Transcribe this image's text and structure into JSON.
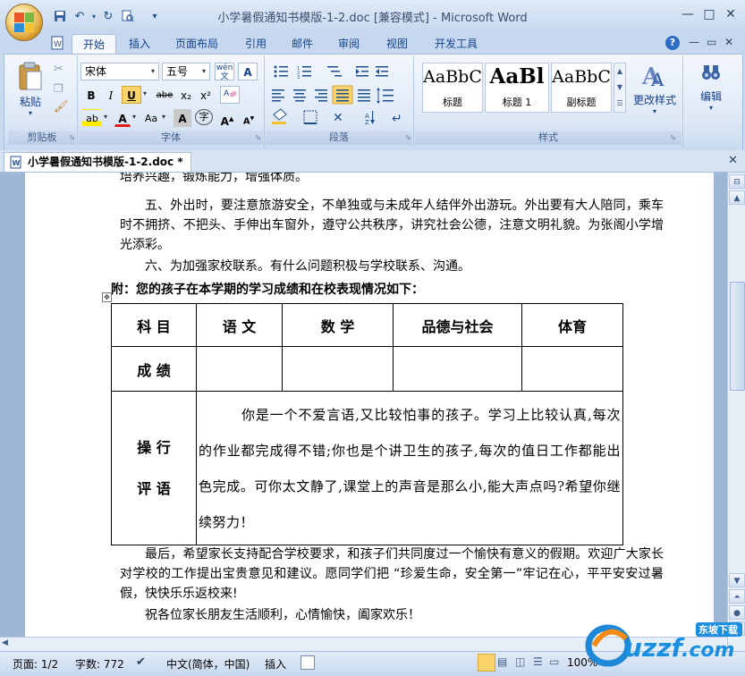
{
  "window": {
    "title": "小学暑假通知书模版-1-2.doc [兼容模式] - Microsoft Word",
    "controls": {
      "minimize": "—",
      "maximize": "□",
      "close": "✕"
    }
  },
  "qat": {
    "customize": "▾"
  },
  "ribbon": {
    "tabs": [
      "开始",
      "插入",
      "页面布局",
      "引用",
      "邮件",
      "审阅",
      "视图",
      "开发工具"
    ],
    "active_tab": "开始",
    "help": "?",
    "clipboard": {
      "label": "剪贴板",
      "paste": "粘贴"
    },
    "font": {
      "label": "字体",
      "name": "宋体",
      "size": "五号",
      "phonetic": "wén",
      "bold": "B",
      "italic": "I",
      "underline": "U",
      "strike": "abe",
      "subscript": "x₂",
      "superscript": "x²",
      "highlight": "ab",
      "font_color": "A",
      "case": "Aa",
      "shade": "A",
      "enclose": "字",
      "grow": "A",
      "shrink": "A",
      "border_char": "A"
    },
    "paragraph": {
      "label": "段落"
    },
    "styles": {
      "label": "样式",
      "items": [
        {
          "sample": "AaBbC",
          "name": "标题"
        },
        {
          "sample": "AaBl",
          "name": "标题 1"
        },
        {
          "sample": "AaBbC",
          "name": "副标题"
        }
      ],
      "change": "更改样式"
    },
    "editing": {
      "label": "编辑"
    }
  },
  "document": {
    "tab_title": "小学暑假通知书模版-1-2.doc *",
    "paragraphs": {
      "p0": "培养兴趣，锻炼能力，增强体质。",
      "p5": "五、外出时，要注意旅游安全，不单独或与未成年人结伴外出游玩。外出要有大人陪同，乘车时不拥挤、不把头、手伸出车窗外，遵守公共秩序，讲究社会公德，注意文明礼貌。为张阁小学增光添彩。",
      "p6": "六、为加强家校联系。有什么问题积极与学校联系、沟通。",
      "appendix": "附：您的孩子在本学期的学习成绩和在校表现情况如下：",
      "closing": "最后，希望家长支持配合学校要求，和孩子们共同度过一个愉快有意义的假期。欢迎广大家长对学校的工作提出宝贵意见和建议。愿同学们把 “珍爱生命，安全第一”牢记在心，平平安安过暑假，快快乐乐返校来!",
      "wish": "祝各位家长朋友生活顺利，心情愉快，阖家欢乐！"
    },
    "table": {
      "headers": [
        "科 目",
        "语 文",
        "数 学",
        "品德与社会",
        "体育"
      ],
      "score_label": "成 绩",
      "scores": [
        "",
        "",
        "",
        ""
      ],
      "comment_label_1": "操 行",
      "comment_label_2": "评 语",
      "comment": "你是一个不爱言语,又比较怕事的孩子。学习上比较认真,每次的作业都完成得不错;你也是个讲卫生的孩子,每次的值日工作都能出色完成。可你太文静了,课堂上的声音是那么小,能大声点吗?希望你继续努力！"
    }
  },
  "statusbar": {
    "page": "页面: 1/2",
    "words": "字数: 772",
    "language": "中文(简体，中国)",
    "mode": "插入",
    "zoom": "100%"
  },
  "watermark": {
    "text": "uzzf.com",
    "tagline": "东坡下载"
  },
  "colors": {
    "ribbon_text": "#15428b",
    "page": "#ffffff",
    "doc_bg": "#9eb5d3"
  }
}
